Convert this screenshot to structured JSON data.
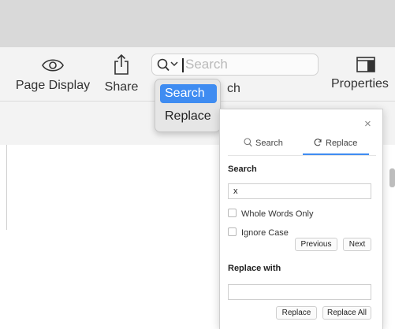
{
  "toolbar": {
    "page_display": {
      "label": "Page Display",
      "icon": "eye-icon"
    },
    "share": {
      "label": "Share",
      "icon": "share-icon"
    },
    "search": {
      "placeholder": "Search",
      "icon": "magnifying-glass-icon",
      "label_partial": "ch"
    },
    "properties": {
      "label": "Properties",
      "icon": "sidebar-panel-icon"
    }
  },
  "search_mode_menu": {
    "items": [
      {
        "label": "Search",
        "selected": true
      },
      {
        "label": "Replace",
        "selected": false
      }
    ]
  },
  "find_panel": {
    "close": "×",
    "tabs": [
      {
        "label": "Search",
        "icon": "magnifying-glass-icon",
        "active": false
      },
      {
        "label": "Replace",
        "icon": "replace-icon",
        "active": true
      }
    ],
    "search_section": {
      "heading": "Search",
      "value": "x",
      "options": [
        {
          "label": "Whole Words Only",
          "checked": false
        },
        {
          "label": "Ignore Case",
          "checked": false
        }
      ],
      "previous_label": "Previous",
      "next_label": "Next"
    },
    "replace_section": {
      "heading": "Replace with",
      "value": "",
      "replace_label": "Replace",
      "replace_all_label": "Replace All"
    }
  },
  "colors": {
    "accent": "#3f8cf1",
    "toolbar_bg": "#f3f3f3",
    "titlebar_bg": "#d9d9d9"
  }
}
